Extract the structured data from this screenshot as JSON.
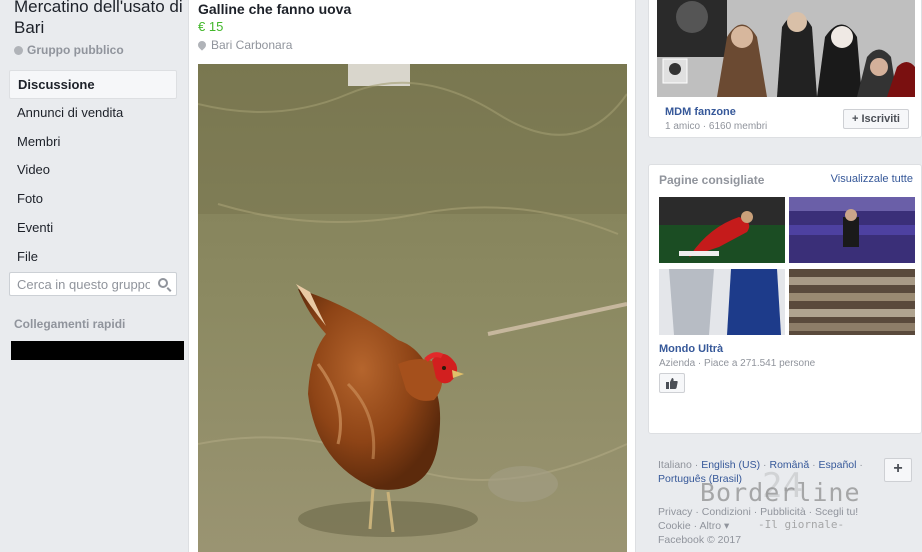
{
  "sidebar": {
    "group_name": "Mercatino dell'usato di Bari",
    "group_type": "Gruppo pubblico",
    "nav": [
      {
        "label": "Discussione"
      },
      {
        "label": "Annunci di vendita"
      },
      {
        "label": "Membri"
      },
      {
        "label": "Video"
      },
      {
        "label": "Foto"
      },
      {
        "label": "Eventi"
      },
      {
        "label": "File"
      }
    ],
    "search_placeholder": "Cerca in questo gruppo",
    "quick_links_title": "Collegamenti rapidi"
  },
  "post": {
    "title": "Galline che fanno uova",
    "price": "€ 15",
    "location": "Bari Carbonara"
  },
  "suggested_group": {
    "name": "MDM fanzone",
    "meta": "1 amico · 6160 membri",
    "join_label": "Iscriviti",
    "join_icon": "plus-icon"
  },
  "suggested_pages": {
    "title": "Pagine consigliate",
    "see_all": "Visualizzale tutte",
    "page_name": "Mondo Ultrà",
    "page_meta": "Azienda · Piace a 271.541 persone",
    "like_icon": "thumbs-up-icon"
  },
  "languages": {
    "current": "Italiano",
    "others": [
      "English (US)",
      "Română",
      "Español",
      "Português (Brasil)"
    ]
  },
  "footer": {
    "links": [
      "Privacy",
      "Condizioni",
      "Pubblicità",
      "Scegli tu!",
      "Cookie",
      "Altro"
    ],
    "copyright": "Facebook © 2017"
  },
  "watermark": {
    "main": "Borderline",
    "number": "24",
    "sub": "-Il giornale-"
  },
  "colors": {
    "background": "#e9ebee",
    "link": "#365899",
    "price": "#42b72a",
    "muted": "#90949c"
  }
}
